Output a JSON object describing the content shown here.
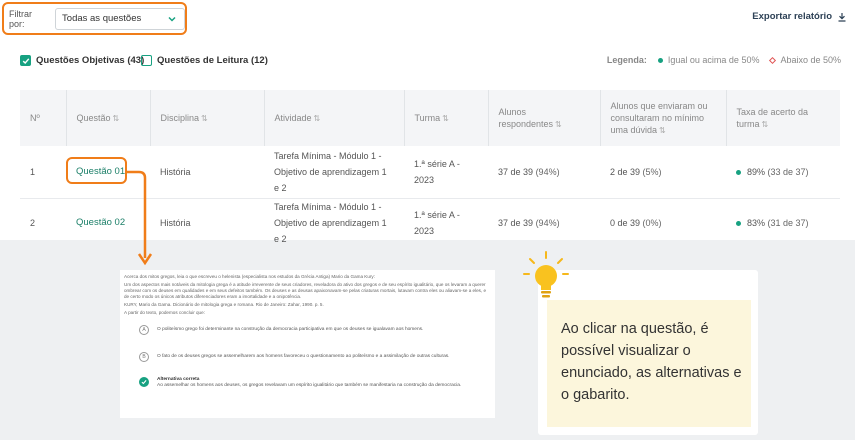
{
  "filter": {
    "label": "Filtrar por:",
    "selected": "Todas as questões"
  },
  "export_label": "Exportar relatório",
  "checkboxes": [
    {
      "label": "Questões Objetivas (43)",
      "checked": true
    },
    {
      "label": "Questões de Leitura (12)",
      "checked": false
    }
  ],
  "legend": {
    "title": "Legenda:",
    "above": "Igual ou acima de 50%",
    "below": "Abaixo de 50%"
  },
  "columns": {
    "num": "Nº",
    "question": "Questão",
    "subject": "Disciplina",
    "activity": "Atividade",
    "class": "Turma",
    "respondents": "Alunos respondentes",
    "consulted": "Alunos que enviaram ou consultaram no mínimo uma dúvida",
    "rate": "Taxa de acerto da turma"
  },
  "rows": [
    {
      "num": "1",
      "question": "Questão 01",
      "subject": "História",
      "activity_l1": "Tarefa Mínima - Módulo 1 -",
      "activity_l2": "Objetivo de aprendizagem 1 e 2",
      "class": "1.ª série A - 2023",
      "resp": "37 de 39",
      "resp_pct": "(94%)",
      "cons": "2 de 39",
      "cons_pct": "(5%)",
      "rate": "89%",
      "rate_detail": "(33 de 37)"
    },
    {
      "num": "2",
      "question": "Questão 02",
      "subject": "História",
      "activity_l1": "Tarefa Mínima - Módulo 1 -",
      "activity_l2": "Objetivo de aprendizagem 1 e 2",
      "class": "1.ª série A - 2023",
      "resp": "37 de 39",
      "resp_pct": "(94%)",
      "cons": "0 de 39",
      "cons_pct": "(0%)",
      "rate": "83%",
      "rate_detail": "(31 de 37)"
    }
  ],
  "preview": {
    "p1": "Acerca dos mitos gregos, leia o que escreveu o helenista (especialista nos estudos da Grécia Antiga) Mario da Gama Kury:",
    "p2": "Um dos aspectos mais notáveis da mitologia grega é a atitude irreverente de seus criadores, reveladora do ativo dos gregos e de seu espírito igualitário, que os levaram a querer ombrear com os deuses em qualidades e em seus defeitos também. Os deuses e as deusas apaixonavam-se pelas criaturas mortais, lutavam contra eles ou aliavam-se a eles, e de certo modo os únicos atributos diferenciadores eram a imortalidade e a onipotência.",
    "source": "KURY, Mario da Gama. Dicionário de mitologia grega e romana. Rio de Janeiro: Zahar, 1990. p. 5.",
    "prompt": "A partir do texto, podemos concluir que:",
    "opt_a_letter": "A",
    "opt_a": "O politeísmo grego foi determinante na construção da democracia participativa em que os deuses se igualavam aos homens.",
    "opt_b_letter": "B",
    "opt_b": "O fato de os deuses gregos se assemelharem aos homens favoreceu o questionamento ao politeísmo e a assimilação de outras culturas.",
    "correct_title": "Alternativa correta",
    "correct_text": "Ao assemelhar os homens aos deuses, os gregos revelavam um espírito igualitário que também se manifestaria na construção da democracia."
  },
  "tip_text": "Ao clicar na questão, é possível visualizar o enunciado, as alternativas e o gabarito.",
  "colors": {
    "accent": "#f07d19",
    "green": "#17a181",
    "link": "#1b7f68",
    "tip_bg": "#fcf6dc"
  }
}
